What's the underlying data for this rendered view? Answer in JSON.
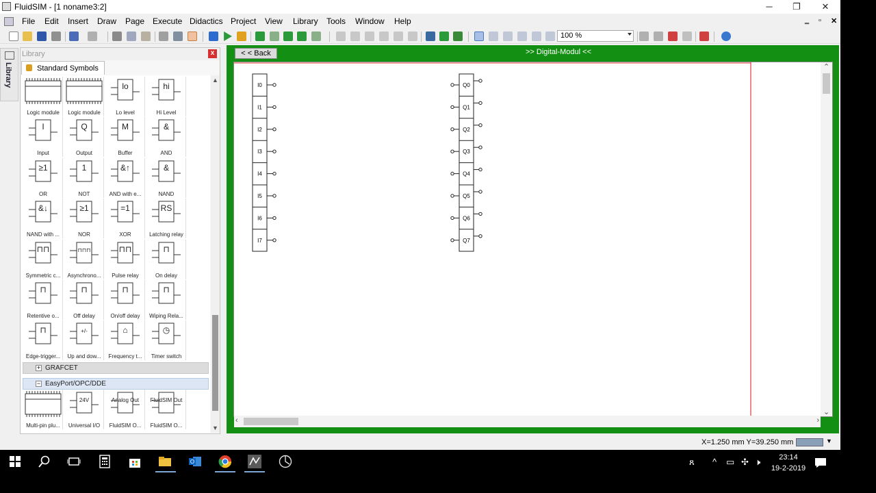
{
  "window": {
    "title": "FluidSIM - [1  noname3:2]",
    "minimize": "─",
    "restore": "❐",
    "close": "✕"
  },
  "menubar": {
    "items": [
      "File",
      "Edit",
      "Insert",
      "Draw",
      "Page",
      "Execute",
      "Didactics",
      "Project",
      "View",
      "Library",
      "Tools",
      "Window",
      "Help"
    ],
    "mdi_min": "‗",
    "mdi_restore": "▫",
    "mdi_close": "✕"
  },
  "toolbar": {
    "zoom": "100 %"
  },
  "sidetab": {
    "label": "Library"
  },
  "library": {
    "title": "Library",
    "close": "x",
    "tab": "Standard Symbols",
    "items": [
      {
        "label": "Logic module",
        "glyph": ""
      },
      {
        "label": "Logic module",
        "glyph": ""
      },
      {
        "label": "Lo level",
        "glyph": "lo"
      },
      {
        "label": "Hi Level",
        "glyph": "hi"
      },
      {
        "label": "Input",
        "glyph": "I"
      },
      {
        "label": "Output",
        "glyph": "Q"
      },
      {
        "label": "Buffer",
        "glyph": "M"
      },
      {
        "label": "AND",
        "glyph": "&"
      },
      {
        "label": "OR",
        "glyph": "≥1"
      },
      {
        "label": "NOT",
        "glyph": "1"
      },
      {
        "label": "AND with e...",
        "glyph": "&↑"
      },
      {
        "label": "NAND",
        "glyph": "&"
      },
      {
        "label": "NAND with ...",
        "glyph": "&↓"
      },
      {
        "label": "NOR",
        "glyph": "≥1"
      },
      {
        "label": "XOR",
        "glyph": "=1"
      },
      {
        "label": "Latching relay",
        "glyph": "RS"
      },
      {
        "label": "Symmetric c...",
        "glyph": "⊓⊓"
      },
      {
        "label": "Asynchrono...",
        "glyph": "⊓⊓⊓"
      },
      {
        "label": "Pulse relay",
        "glyph": "⊓⊓"
      },
      {
        "label": "On delay",
        "glyph": "⊓"
      },
      {
        "label": "Retentive o...",
        "glyph": "⊓"
      },
      {
        "label": "Off delay",
        "glyph": "⊓"
      },
      {
        "label": "On/off delay",
        "glyph": "⊓"
      },
      {
        "label": "Wiping Rela...",
        "glyph": "⊓"
      },
      {
        "label": "Edge-trigger...",
        "glyph": "⊓"
      },
      {
        "label": "Up and dow...",
        "glyph": "+/-"
      },
      {
        "label": "Frequency t...",
        "glyph": "⌂"
      },
      {
        "label": "Timer switch",
        "glyph": "◷"
      }
    ],
    "groups": [
      {
        "label": "GRAFCET",
        "sign": "+"
      },
      {
        "label": "EasyPort/OPC/DDE",
        "sign": "−"
      }
    ],
    "easyport": [
      {
        "label": "Multi-pin plu...",
        "glyph": ""
      },
      {
        "label": "Universal I/O",
        "glyph": "24V"
      },
      {
        "label": "FluidSIM O...",
        "glyph": "Analog Out"
      },
      {
        "label": "FluidSIM O...",
        "glyph": "FluidSIM Out"
      }
    ]
  },
  "canvas": {
    "back": "< < Back",
    "title": ">> Digital-Modul <<",
    "inputs": [
      "I0",
      "I1",
      "I2",
      "I3",
      "I4",
      "I5",
      "I6",
      "I7"
    ],
    "outputs": [
      "Q0",
      "Q1",
      "Q2",
      "Q3",
      "Q4",
      "Q5",
      "Q6",
      "Q7"
    ]
  },
  "status": {
    "coords": "X=1.250 mm  Y=39.250 mm"
  },
  "taskbar": {
    "time": "23:14",
    "date": "19-2-2019"
  },
  "colors": {
    "accent_green": "#139013",
    "page_border": "#e03a3a"
  }
}
